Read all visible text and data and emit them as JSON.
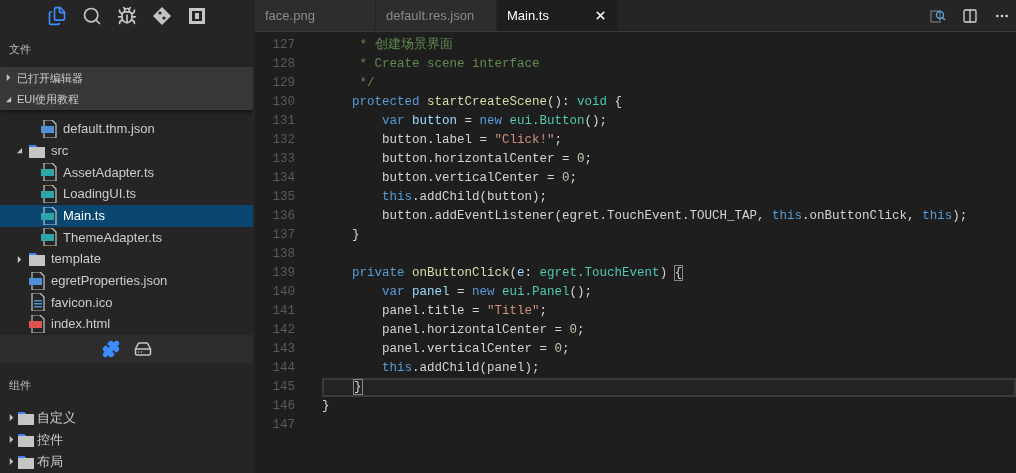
{
  "activity_bar": [
    {
      "kind": "files",
      "selected": true
    },
    {
      "kind": "search",
      "selected": false
    },
    {
      "kind": "debug",
      "selected": false
    },
    {
      "kind": "git",
      "selected": false
    },
    {
      "kind": "frame",
      "selected": false
    }
  ],
  "explorer": {
    "title": "文件",
    "sections": [
      {
        "label": "已打开编辑器",
        "expanded": false
      },
      {
        "label": "EUI使用教程",
        "expanded": true
      }
    ],
    "tree": [
      {
        "kind": "hidden_folder",
        "children": [
          {
            "kind": "json",
            "name": "default.thm.json",
            "selected": false
          }
        ]
      },
      {
        "kind": "folder",
        "name": "src",
        "expanded": true,
        "children": [
          {
            "kind": "ts",
            "name": "AssetAdapter.ts",
            "selected": false
          },
          {
            "kind": "ts",
            "name": "LoadingUI.ts",
            "selected": false
          },
          {
            "kind": "ts",
            "name": "Main.ts",
            "selected": true
          },
          {
            "kind": "ts",
            "name": "ThemeAdapter.ts",
            "selected": false
          }
        ]
      },
      {
        "kind": "folder",
        "name": "template",
        "expanded": false
      },
      {
        "kind": "json",
        "name": "egretProperties.json",
        "selected": false
      },
      {
        "kind": "text",
        "name": "favicon.ico",
        "selected": false
      },
      {
        "kind": "html",
        "name": "index.html",
        "selected": false
      }
    ],
    "toolbar": [
      {
        "kind": "puzzle"
      },
      {
        "kind": "drive"
      }
    ]
  },
  "components": {
    "title": "组件",
    "items": [
      {
        "label": "自定义",
        "expanded": false
      },
      {
        "label": "控件",
        "expanded": false
      },
      {
        "label": "布局",
        "expanded": false
      }
    ]
  },
  "tabs": [
    {
      "label": "face.png",
      "selected": false
    },
    {
      "label": "default.res.json",
      "selected": false
    },
    {
      "label": "Main.ts",
      "selected": true
    }
  ],
  "editor_actions": [
    {
      "kind": "find"
    },
    {
      "kind": "split"
    },
    {
      "kind": "more"
    }
  ],
  "lines": [
    {
      "number": "127",
      "current": false,
      "tokens": [
        {
          "t": "     * 创建场景界面",
          "kind": "comment"
        }
      ]
    },
    {
      "number": "128",
      "current": false,
      "tokens": [
        {
          "t": "     * Create scene interface",
          "kind": "comment"
        }
      ]
    },
    {
      "number": "129",
      "current": false,
      "tokens": [
        {
          "t": "     */",
          "kind": "comment"
        }
      ]
    },
    {
      "number": "130",
      "current": false,
      "tokens": [
        {
          "t": "    protected ",
          "kind": "keyword"
        },
        {
          "t": "startCreateScene",
          "kind": "function"
        },
        {
          "t": "(): ",
          "kind": "plain"
        },
        {
          "t": "void",
          "kind": "type"
        },
        {
          "t": " {",
          "kind": "plain"
        }
      ]
    },
    {
      "number": "131",
      "current": false,
      "tokens": [
        {
          "t": "        var ",
          "kind": "keyword"
        },
        {
          "t": "button",
          "kind": "variable"
        },
        {
          "t": " = ",
          "kind": "plain"
        },
        {
          "t": "new ",
          "kind": "keyword"
        },
        {
          "t": "eui.Button",
          "kind": "type"
        },
        {
          "t": "();",
          "kind": "plain"
        }
      ]
    },
    {
      "number": "132",
      "current": false,
      "tokens": [
        {
          "t": "        button.label = ",
          "kind": "plain"
        },
        {
          "t": "\"Click!\"",
          "kind": "string"
        },
        {
          "t": ";",
          "kind": "plain"
        }
      ]
    },
    {
      "number": "133",
      "current": false,
      "tokens": [
        {
          "t": "        button.horizontalCenter = ",
          "kind": "plain"
        },
        {
          "t": "0",
          "kind": "number"
        },
        {
          "t": ";",
          "kind": "plain"
        }
      ]
    },
    {
      "number": "134",
      "current": false,
      "tokens": [
        {
          "t": "        button.verticalCenter = ",
          "kind": "plain"
        },
        {
          "t": "0",
          "kind": "number"
        },
        {
          "t": ";",
          "kind": "plain"
        }
      ]
    },
    {
      "number": "135",
      "current": false,
      "tokens": [
        {
          "t": "        this",
          "kind": "keyword"
        },
        {
          "t": ".addChild(button);",
          "kind": "plain"
        }
      ]
    },
    {
      "number": "136",
      "current": false,
      "tokens": [
        {
          "t": "        button.addEventListener(egret.TouchEvent.TOUCH_TAP, ",
          "kind": "plain"
        },
        {
          "t": "this",
          "kind": "keyword"
        },
        {
          "t": ".onButtonClick, ",
          "kind": "plain"
        },
        {
          "t": "this",
          "kind": "keyword"
        },
        {
          "t": ");",
          "kind": "plain"
        }
      ]
    },
    {
      "number": "137",
      "current": false,
      "tokens": [
        {
          "t": "    }",
          "kind": "plain"
        }
      ]
    },
    {
      "number": "138",
      "current": false
    },
    {
      "number": "139",
      "current": false,
      "tokens": [
        {
          "t": "    private ",
          "kind": "keyword"
        },
        {
          "t": "onButtonClick",
          "kind": "function"
        },
        {
          "t": "(",
          "kind": "plain"
        },
        {
          "t": "e",
          "kind": "variable"
        },
        {
          "t": ": ",
          "kind": "plain"
        },
        {
          "t": "egret.TouchEvent",
          "kind": "type"
        },
        {
          "t": ") ",
          "kind": "plain"
        },
        {
          "t": "{",
          "kind": "bracket_match"
        }
      ]
    },
    {
      "number": "140",
      "current": false,
      "tokens": [
        {
          "t": "        var ",
          "kind": "keyword"
        },
        {
          "t": "panel",
          "kind": "variable"
        },
        {
          "t": " = ",
          "kind": "plain"
        },
        {
          "t": "new ",
          "kind": "keyword"
        },
        {
          "t": "eui.Panel",
          "kind": "type"
        },
        {
          "t": "();",
          "kind": "plain"
        }
      ]
    },
    {
      "number": "141",
      "current": false,
      "tokens": [
        {
          "t": "        panel.title = ",
          "kind": "plain"
        },
        {
          "t": "\"Title\"",
          "kind": "string"
        },
        {
          "t": ";",
          "kind": "plain"
        }
      ]
    },
    {
      "number": "142",
      "current": false,
      "tokens": [
        {
          "t": "        panel.horizontalCenter = ",
          "kind": "plain"
        },
        {
          "t": "0",
          "kind": "number"
        },
        {
          "t": ";",
          "kind": "plain"
        }
      ]
    },
    {
      "number": "143",
      "current": false,
      "tokens": [
        {
          "t": "        panel.verticalCenter = ",
          "kind": "plain"
        },
        {
          "t": "0",
          "kind": "number"
        },
        {
          "t": ";",
          "kind": "plain"
        }
      ]
    },
    {
      "number": "144",
      "current": false,
      "tokens": [
        {
          "t": "        this",
          "kind": "keyword"
        },
        {
          "t": ".addChild(panel);",
          "kind": "plain"
        }
      ]
    },
    {
      "number": "145",
      "current": true,
      "tokens": [
        {
          "t": "    }",
          "kind": "bracket_match"
        }
      ]
    },
    {
      "number": "146",
      "current": false,
      "tokens": [
        {
          "t": "}",
          "kind": "plain"
        }
      ]
    },
    {
      "number": "147",
      "current": false
    }
  ]
}
